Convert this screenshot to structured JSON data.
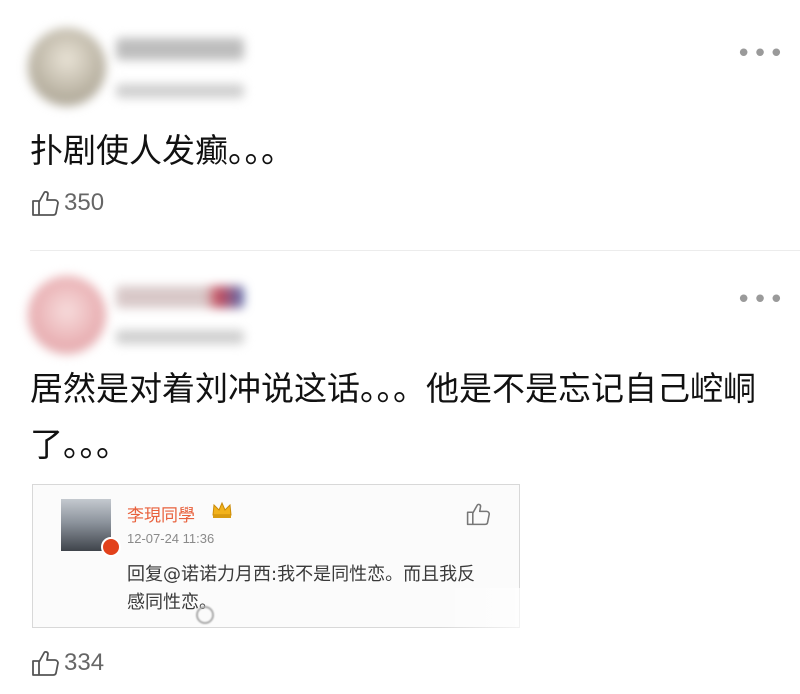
{
  "comment_1": {
    "text": "扑剧使人发癫。。。",
    "likes": "350",
    "more_icon": "more-dots-icon",
    "like_icon": "thumbs-up-icon"
  },
  "comment_2": {
    "text_line1": "居然是对着刘冲说这话。。。他是不是忘记自己崆峒",
    "text_line2": "了。。。",
    "likes": "334",
    "more_icon": "more-dots-icon",
    "like_icon": "thumbs-up-icon"
  },
  "quoted_post": {
    "username": "李現同學",
    "timestamp": "12-07-24 11:36",
    "content": "回复@诺诺力月西:我不是同性恋。而且我反感同性恋。",
    "crown_icon": "crown-icon",
    "like_icon": "thumbs-up-icon",
    "name_color": "#e8613d"
  }
}
